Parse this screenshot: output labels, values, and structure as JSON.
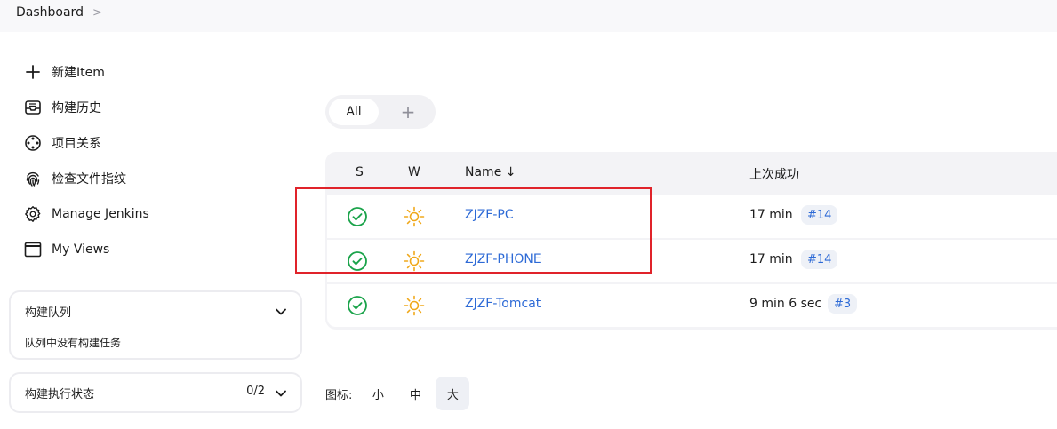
{
  "breadcrumb": {
    "dashboard": "Dashboard",
    "separator": ">"
  },
  "sidebar": {
    "items": [
      {
        "label": "新建Item",
        "icon": "plus-icon"
      },
      {
        "label": "构建历史",
        "icon": "inbox-icon"
      },
      {
        "label": "项目关系",
        "icon": "relationship-icon"
      },
      {
        "label": "检查文件指纹",
        "icon": "fingerprint-icon"
      },
      {
        "label": "Manage Jenkins",
        "icon": "gear-icon"
      },
      {
        "label": "My Views",
        "icon": "window-icon"
      }
    ]
  },
  "build_queue": {
    "title": "构建队列",
    "empty_text": "队列中没有构建任务"
  },
  "executor_status": {
    "title": "构建执行状态",
    "count": "0/2"
  },
  "view_tabs": {
    "all": "All",
    "add": "+"
  },
  "jobs_table": {
    "headers": {
      "s": "S",
      "w": "W",
      "name": "Name ↓",
      "last_success": "上次成功"
    },
    "rows": [
      {
        "name": "ZJZF-PC",
        "last_success": "17 min",
        "build": "#14",
        "status_icon": "success-check-icon",
        "weather_icon": "sunny-icon"
      },
      {
        "name": "ZJZF-PHONE",
        "last_success": "17 min",
        "build": "#14",
        "status_icon": "success-check-icon",
        "weather_icon": "sunny-icon"
      },
      {
        "name": "ZJZF-Tomcat",
        "last_success": "9 min 6 sec",
        "build": "#3",
        "status_icon": "success-check-icon",
        "weather_icon": "sunny-icon"
      }
    ]
  },
  "icon_size": {
    "label": "图标:",
    "small": "小",
    "medium": "中",
    "large": "大",
    "selected": "大"
  },
  "colors": {
    "link": "#2d6ad6",
    "success": "#1aa34a",
    "sunny": "#f0a81a",
    "highlight": "#e0232a"
  }
}
